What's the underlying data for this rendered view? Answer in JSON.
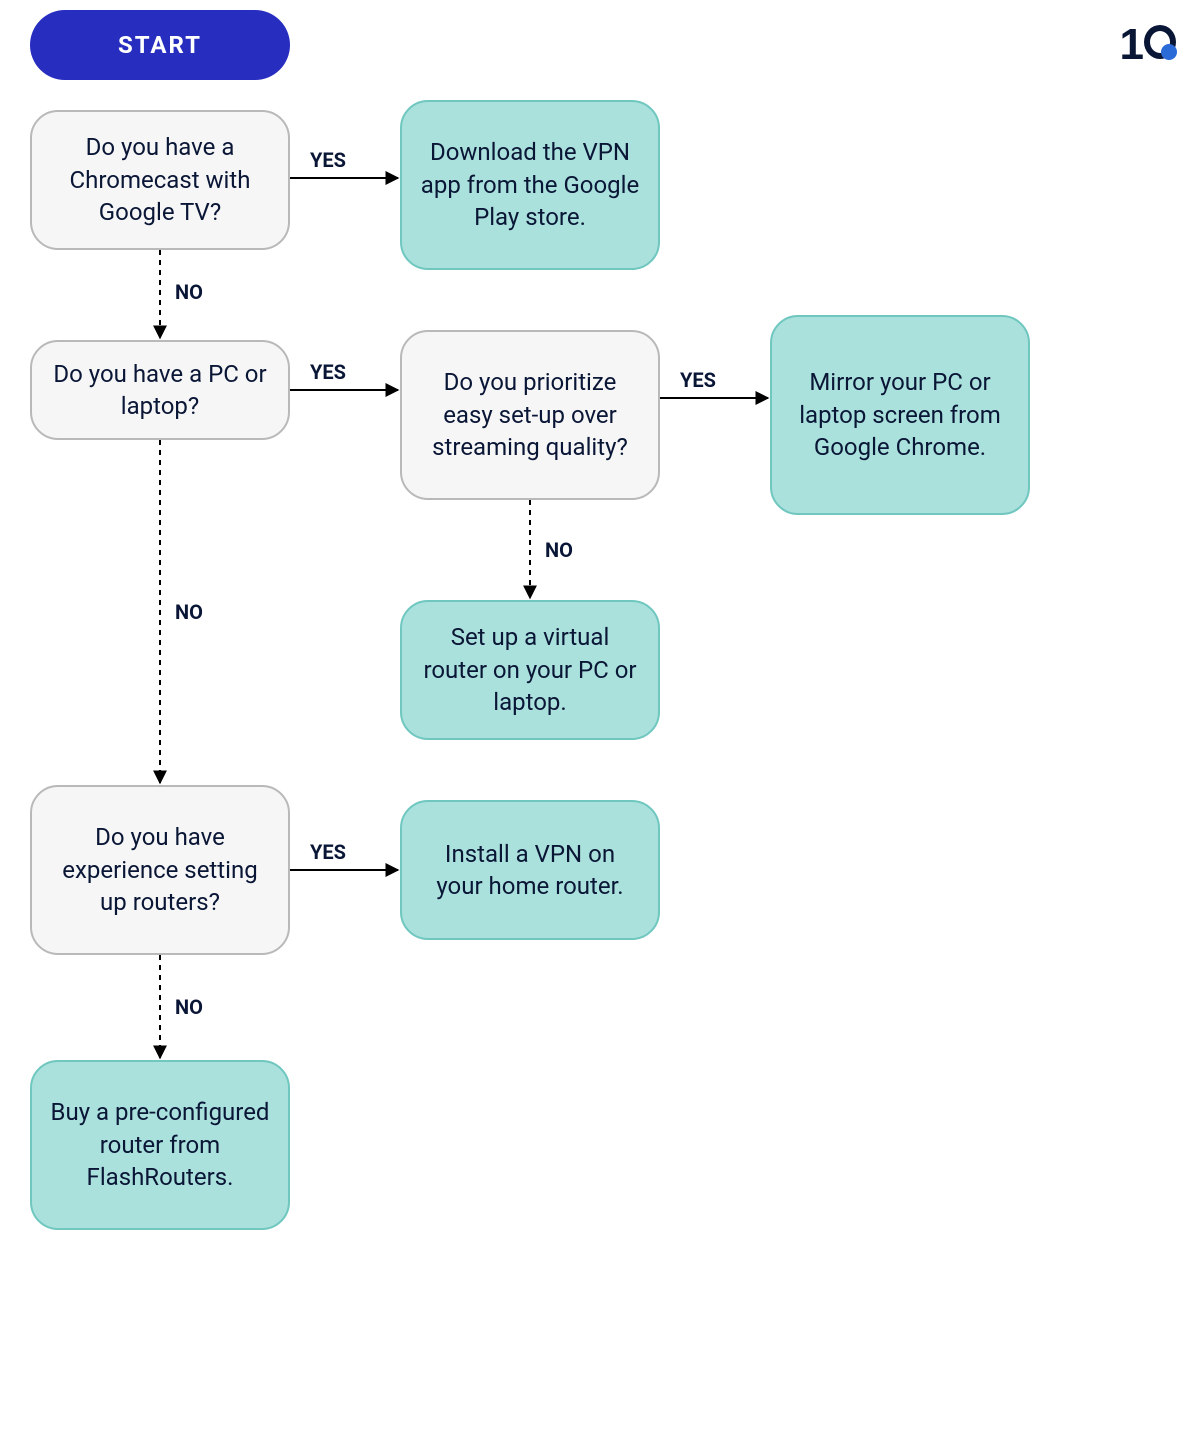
{
  "logo": {
    "digit_one": "1"
  },
  "labels": {
    "yes": "YES",
    "no": "NO"
  },
  "nodes": {
    "start": {
      "text": "START"
    },
    "q1": {
      "text": "Do you have a Chromecast with Google TV?"
    },
    "a1": {
      "text": "Download the VPN app from the Google Play store."
    },
    "q2": {
      "text": "Do you have a PC or laptop?"
    },
    "q3": {
      "text": "Do you prioritize easy set-up over streaming quality?"
    },
    "a2": {
      "text": "Mirror your PC or laptop screen from Google Chrome."
    },
    "a3": {
      "text": "Set up a virtual router on your PC or laptop."
    },
    "q4": {
      "text": "Do you have experience setting up routers?"
    },
    "a4": {
      "text": "Install a VPN on your home router."
    },
    "a5": {
      "text": "Buy a pre-configured router from FlashRouters."
    }
  },
  "edges": [
    {
      "from": "q1",
      "to": "a1",
      "label_key": "yes"
    },
    {
      "from": "q1",
      "to": "q2",
      "label_key": "no"
    },
    {
      "from": "q2",
      "to": "q3",
      "label_key": "yes"
    },
    {
      "from": "q2",
      "to": "q4",
      "label_key": "no"
    },
    {
      "from": "q3",
      "to": "a2",
      "label_key": "yes"
    },
    {
      "from": "q3",
      "to": "a3",
      "label_key": "no"
    },
    {
      "from": "q4",
      "to": "a4",
      "label_key": "yes"
    },
    {
      "from": "q4",
      "to": "a5",
      "label_key": "no"
    }
  ]
}
